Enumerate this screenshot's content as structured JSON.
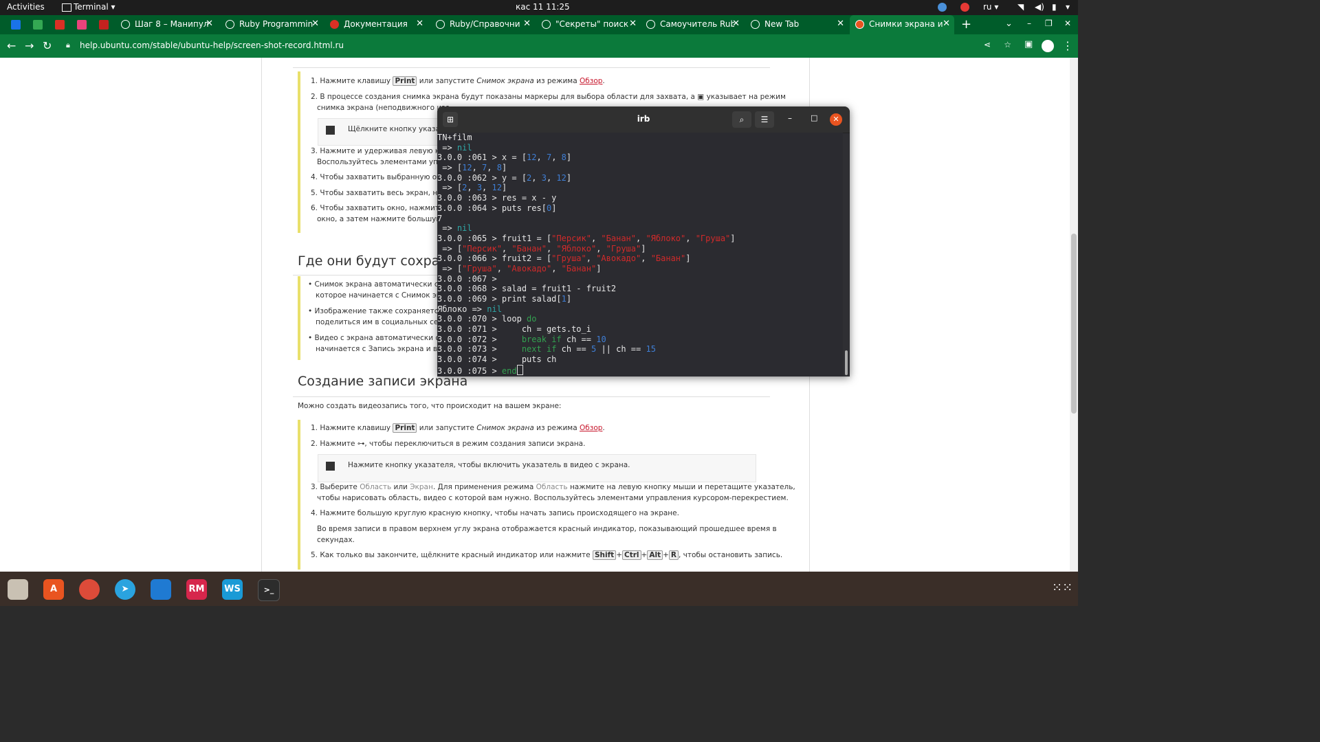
{
  "topbar": {
    "activities": "Activities",
    "app": "Terminal ▾",
    "datetime": "кас 11  11:25",
    "lang": "ru ▾"
  },
  "tabs": [
    {
      "label": "Шаг 8 – Манипул"
    },
    {
      "label": "Ruby Programmin"
    },
    {
      "label": "Документация"
    },
    {
      "label": "Ruby/Справочни"
    },
    {
      "label": "\"Секреты\" поиск"
    },
    {
      "label": "Самоучитель Rub"
    },
    {
      "label": "New Tab"
    },
    {
      "label": "Снимки экрана и"
    }
  ],
  "url": "help.ubuntu.com/stable/ubuntu-help/screen-shot-record.html.ru",
  "page": {
    "top_list": [
      "1. Нажмите клавишу",
      "2. В процессе создания снимка экрана будут показаны маркеры для выбора области для захвата, а",
      "снимка экрана (неподвижного изо",
      "Щёлкните кнопку указате",
      "3. Нажмите и удерживая левую кноп",
      "Воспользуйтесь элементами упра",
      "4. Чтобы захватить выбранную обла",
      "5. Чтобы захватить весь экран, нажм",
      "6. Чтобы захватить окно, нажмите О",
      "окно, а затем нажмите большую к"
    ],
    "key_print": "Print",
    "or_start": "или запустите",
    "snapshot_em": "Снимок экрана",
    "from_mode": "из режима",
    "overview_link": "Обзор",
    "indicates_mode": "указывает на режим",
    "h2_where": "Где они будут сохране",
    "where_list": [
      "Снимок экрана автоматически сохр",
      "которое начинается с Снимок экран",
      "Изображение также сохраняется в",
      "поделиться им в социальных сетях",
      "Видео с экрана автоматически сохр",
      "начинается с Запись экрана и вклю"
    ],
    "h2_record": "Создание записи экрана",
    "intro": "Можно создать видеозапись того, что происходит на вашем экране:",
    "rec_1_a": "1. Нажмите клавишу",
    "rec_2": "2. Нажмите",
    "rec_2_b": ", чтобы переключиться в режим создания записи экрана.",
    "rec_note": "Нажмите кнопку указателя, чтобы включить указатель в видео с экрана.",
    "rec_3_a": "3. Выберите",
    "area": "Область",
    "or": "или",
    "screen": "Экран",
    "rec_3_b": ". Для применения режима",
    "rec_3_c": "нажмите на левую кнопку мыши и перетащите указатель,",
    "rec_3_d": "чтобы нарисовать область, видео с которой вам нужно. Воспользуйтесь элементами управления курсором-перекрестием.",
    "rec_4": "4. Нажмите большую круглую красную кнопку, чтобы начать запись происходящего на экране.",
    "rec_4_b": "Во время записи в правом верхнем углу экрана отображается красный индикатор, показывающий прошедшее время в",
    "rec_4_c": "секундах.",
    "rec_5_a": "5. Как только вы закончите, щёлкните красный индикатор или нажмите",
    "k_shift": "Shift",
    "k_ctrl": "Ctrl",
    "k_alt": "Alt",
    "k_r": "R",
    "rec_5_b": ", чтобы остановить запись.",
    "plus": "+"
  },
  "terminal": {
    "title": "irb",
    "lines": [
      [
        [
          "TN+film",
          ""
        ]
      ],
      [
        [
          " => ",
          ""
        ],
        [
          "nil",
          "nil"
        ]
      ],
      [
        [
          "3.0.0 :061 > x = [",
          ""
        ],
        [
          "12",
          "n"
        ],
        [
          ", ",
          ""
        ],
        [
          "7",
          "n"
        ],
        [
          ", ",
          ""
        ],
        [
          "8",
          "n"
        ],
        [
          "]",
          ""
        ]
      ],
      [
        [
          " => [",
          ""
        ],
        [
          "12",
          "n"
        ],
        [
          ", ",
          ""
        ],
        [
          "7",
          "n"
        ],
        [
          ", ",
          ""
        ],
        [
          "8",
          "n"
        ],
        [
          "]",
          ""
        ]
      ],
      [
        [
          "3.0.0 :062 > y = [",
          ""
        ],
        [
          "2",
          "n"
        ],
        [
          ", ",
          ""
        ],
        [
          "3",
          "n"
        ],
        [
          ", ",
          ""
        ],
        [
          "12",
          "n"
        ],
        [
          "]",
          ""
        ]
      ],
      [
        [
          " => [",
          ""
        ],
        [
          "2",
          "n"
        ],
        [
          ", ",
          ""
        ],
        [
          "3",
          "n"
        ],
        [
          ", ",
          ""
        ],
        [
          "12",
          "n"
        ],
        [
          "]",
          ""
        ]
      ],
      [
        [
          "3.0.0 :063 > res = x - y",
          ""
        ]
      ],
      [
        [
          "3.0.0 :064 > puts res[",
          ""
        ],
        [
          "0",
          "n"
        ],
        [
          "]",
          ""
        ]
      ],
      [
        [
          "7",
          ""
        ]
      ],
      [
        [
          " => ",
          ""
        ],
        [
          "nil",
          "nil"
        ]
      ],
      [
        [
          "3.0.0 :065 > fruit1 = [",
          ""
        ],
        [
          "\"Персик\"",
          "s"
        ],
        [
          ", ",
          ""
        ],
        [
          "\"Банан\"",
          "s"
        ],
        [
          ", ",
          ""
        ],
        [
          "\"Яблоко\"",
          "s"
        ],
        [
          ", ",
          ""
        ],
        [
          "\"Груша\"",
          "s"
        ],
        [
          "]",
          ""
        ]
      ],
      [
        [
          " => [",
          ""
        ],
        [
          "\"Персик\"",
          "s"
        ],
        [
          ", ",
          ""
        ],
        [
          "\"Банан\"",
          "s"
        ],
        [
          ", ",
          ""
        ],
        [
          "\"Яблоко\"",
          "s"
        ],
        [
          ", ",
          ""
        ],
        [
          "\"Груша\"",
          "s"
        ],
        [
          "]",
          ""
        ]
      ],
      [
        [
          "3.0.0 :066 > fruit2 = [",
          ""
        ],
        [
          "\"Груша\"",
          "s"
        ],
        [
          ", ",
          ""
        ],
        [
          "\"Авокадо\"",
          "s"
        ],
        [
          ", ",
          ""
        ],
        [
          "\"Банан\"",
          "s"
        ],
        [
          "]",
          ""
        ]
      ],
      [
        [
          " => [",
          ""
        ],
        [
          "\"Груша\"",
          "s"
        ],
        [
          ", ",
          ""
        ],
        [
          "\"Авокадо\"",
          "s"
        ],
        [
          ", ",
          ""
        ],
        [
          "\"Банан\"",
          "s"
        ],
        [
          "]",
          ""
        ]
      ],
      [
        [
          "3.0.0 :067 >",
          ""
        ]
      ],
      [
        [
          "3.0.0 :068 > salad = fruit1 - fruit2",
          ""
        ]
      ],
      [
        [
          "3.0.0 :069 > print salad[",
          ""
        ],
        [
          "1",
          "n"
        ],
        [
          "]",
          ""
        ]
      ],
      [
        [
          "Яблоко => ",
          ""
        ],
        [
          "nil",
          "nil"
        ]
      ],
      [
        [
          "3.0.0 :070 > loop ",
          ""
        ],
        [
          "do",
          "k"
        ]
      ],
      [
        [
          "3.0.0 :071 >     ch = gets.to_i",
          ""
        ]
      ],
      [
        [
          "3.0.0 :072 >     ",
          ""
        ],
        [
          "break",
          "k"
        ],
        [
          " ",
          ""
        ],
        [
          "if",
          "k"
        ],
        [
          " ch == ",
          ""
        ],
        [
          "10",
          "n"
        ]
      ],
      [
        [
          "3.0.0 :073 >     ",
          ""
        ],
        [
          "next",
          "k"
        ],
        [
          " ",
          ""
        ],
        [
          "if",
          "k"
        ],
        [
          " ch == ",
          ""
        ],
        [
          "5",
          "n"
        ],
        [
          " || ch == ",
          ""
        ],
        [
          "15",
          "n"
        ]
      ],
      [
        [
          "3.0.0 :074 >     puts ch",
          ""
        ]
      ],
      [
        [
          "3.0.0 :075 > ",
          ""
        ],
        [
          "end",
          "k"
        ]
      ]
    ]
  },
  "dock": [
    "RM",
    "WS",
    ">_"
  ]
}
